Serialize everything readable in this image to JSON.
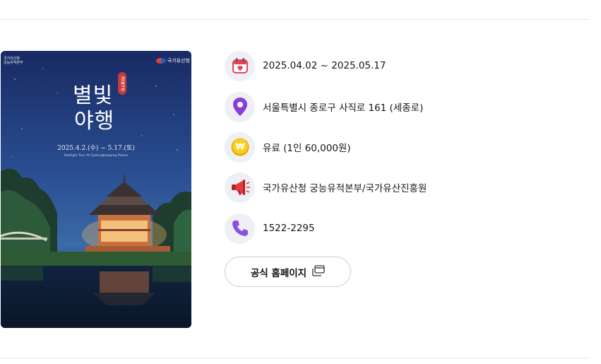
{
  "poster": {
    "org": "국가유산청\n궁능유적본부",
    "brand": "국가유산청",
    "title_line1": "별빛",
    "title_line2": "야행",
    "palace_tag": "경복궁",
    "date": "2025.4.2.(수) ~ 5.17.(토)",
    "english": "Starlight Tour At Gyeongbokgung Palace"
  },
  "info": {
    "period": "2025.04.02 ~ 2025.05.17",
    "address": "서울특별시 종로구 사직로 161 (세종로)",
    "fee": "유료 (1인 60,000원)",
    "organizer": "국가유산청 궁능유적본부/국가유산진흥원",
    "phone": "1522-2295"
  },
  "homepage_button": {
    "label": "공식 홈페이지"
  },
  "icons": {
    "period": "calendar-icon",
    "address": "location-pin-icon",
    "fee": "won-coin-icon",
    "organizer": "megaphone-icon",
    "phone": "phone-icon",
    "homepage": "external-window-icon"
  },
  "colors": {
    "icon_bg": "#eef0f5",
    "pin": "#8b3dd6",
    "coin": "#f5c400",
    "megaphone": "#e43b3b",
    "phone": "#8a4ee0",
    "calendar": "#e8425a"
  }
}
